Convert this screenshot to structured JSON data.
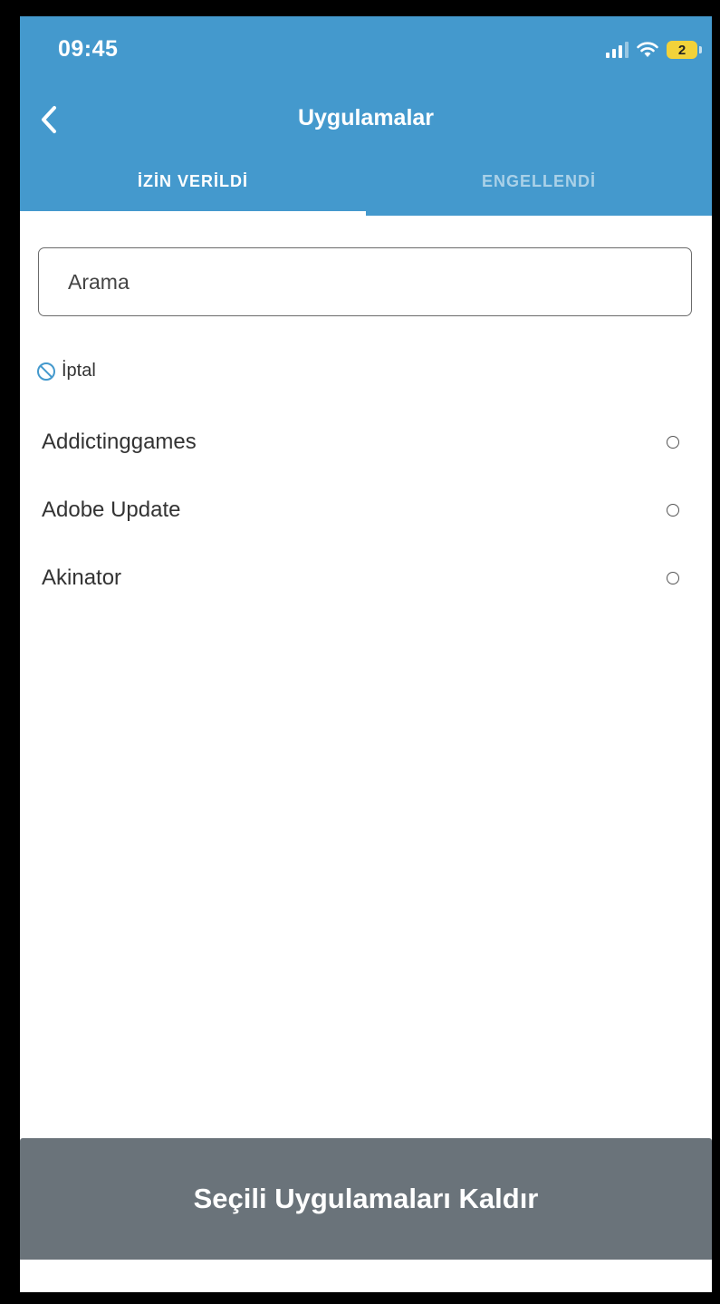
{
  "status_bar": {
    "time": "09:45",
    "battery_level": "2",
    "icons": [
      "signal-icon",
      "wifi-icon",
      "battery-icon"
    ]
  },
  "navbar": {
    "title": "Uygulamalar",
    "back_icon": "chevron-left-icon"
  },
  "tabs": [
    {
      "label": "İZİN VERİLDİ",
      "active": true
    },
    {
      "label": "ENGELLENDİ",
      "active": false
    }
  ],
  "search": {
    "placeholder": "Arama"
  },
  "cancel": {
    "label": "İptal",
    "icon": "prohibited-icon"
  },
  "apps": [
    {
      "name": "Addictinggames",
      "selected": false
    },
    {
      "name": "Adobe Update",
      "selected": false
    },
    {
      "name": "Akinator",
      "selected": false
    }
  ],
  "footer": {
    "button_label": "Seçili Uygulamaları Kaldır"
  },
  "colors": {
    "header_blue": "#4499cd",
    "footer_gray": "#6a737a",
    "battery_yellow": "#f2d23a"
  }
}
